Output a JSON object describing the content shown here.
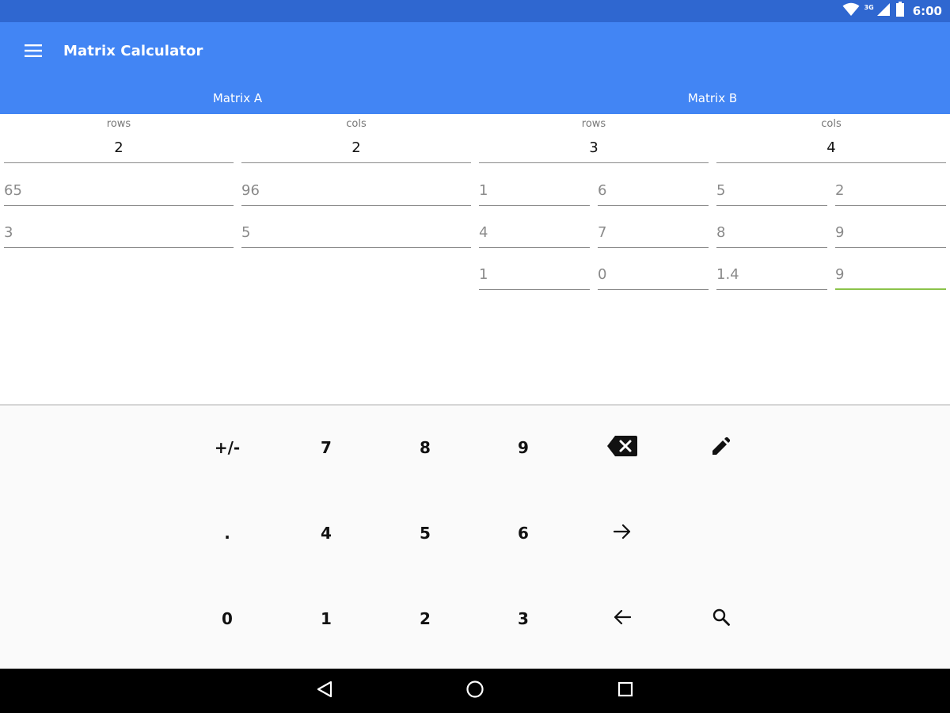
{
  "status_bar": {
    "time": "6:00",
    "network": "3G"
  },
  "app": {
    "title": "Matrix Calculator"
  },
  "tabs": [
    {
      "label": "Matrix A"
    },
    {
      "label": "Matrix B"
    }
  ],
  "matrix_a": {
    "rows_label": "rows",
    "cols_label": "cols",
    "rows": "2",
    "cols": "2",
    "cells": [
      [
        "65",
        "96"
      ],
      [
        "3",
        "5"
      ]
    ]
  },
  "matrix_b": {
    "rows_label": "rows",
    "cols_label": "cols",
    "rows": "3",
    "cols": "4",
    "cells": [
      [
        "1",
        "6",
        "5",
        "2"
      ],
      [
        "4",
        "7",
        "8",
        "9"
      ],
      [
        "1",
        "0",
        "1.4",
        "9"
      ]
    ]
  },
  "keypad": {
    "plus_minus": "+/-",
    "seven": "7",
    "eight": "8",
    "nine": "9",
    "dot": ".",
    "four": "4",
    "five": "5",
    "six": "6",
    "zero": "0",
    "one": "1",
    "two": "2",
    "three": "3"
  },
  "colors": {
    "status_bar": "#2f67d0",
    "app_bar": "#4285f4",
    "active_underline": "#8bc34a"
  }
}
